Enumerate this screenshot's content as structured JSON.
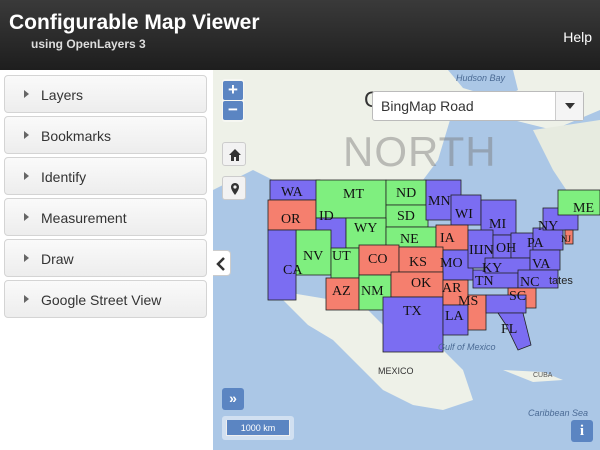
{
  "header": {
    "title": "Configurable Map Viewer",
    "subtitle": "using OpenLayers 3",
    "help_label": "Help"
  },
  "sidebar": {
    "panels": [
      {
        "label": "Layers"
      },
      {
        "label": "Bookmarks"
      },
      {
        "label": "Identify"
      },
      {
        "label": "Measurement"
      },
      {
        "label": "Draw"
      },
      {
        "label": "Google Street View"
      }
    ]
  },
  "map": {
    "zoom_in": "+",
    "zoom_out": "−",
    "basemap_selected": "BingMap Road",
    "basemap_partial_label": "C",
    "overview_button": "»",
    "scale_label": "1000 km",
    "info_button": "i",
    "north_watermark": "NORTH",
    "geo_labels": {
      "hudson_bay": "Hudson Bay",
      "gulf_of_mexico": "Gulf of Mexico",
      "caribbean_sea": "Caribbean Sea",
      "mexico": "MEXICO",
      "cuba": "CUBA",
      "states_text": "tates"
    },
    "state_labels": [
      "WA",
      "OR",
      "MT",
      "ID",
      "ND",
      "SD",
      "WY",
      "NE",
      "MN",
      "WI",
      "IA",
      "MI",
      "NV",
      "UT",
      "CO",
      "KS",
      "MO",
      "IL",
      "IN",
      "OH",
      "PA",
      "NY",
      "ME",
      "CA",
      "AZ",
      "NM",
      "OK",
      "TX",
      "AR",
      "LA",
      "MS",
      "TN",
      "KY",
      "VA",
      "NC",
      "SC",
      "FL",
      "NJ"
    ],
    "colors": {
      "blue_state": "#7b6df2",
      "red_state": "#f57f6e",
      "green_state": "#7fef7f",
      "accent": "#5b85c2"
    }
  }
}
